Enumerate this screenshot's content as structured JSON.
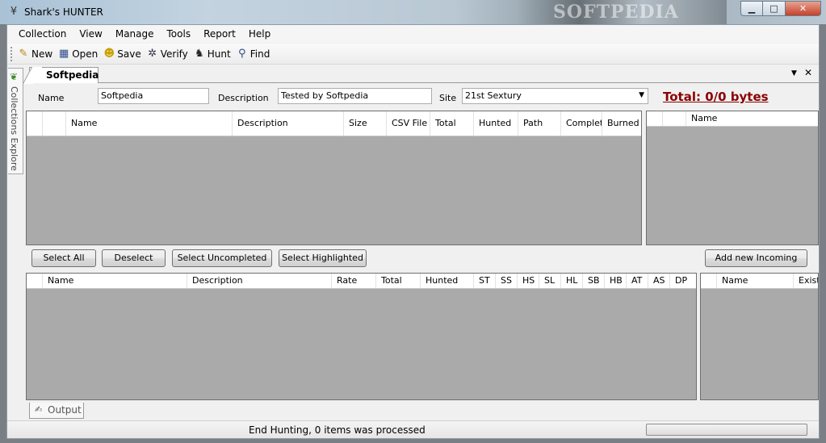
{
  "window": {
    "title": "Shark's HUNTER",
    "watermark": "SOFTPEDIA",
    "controls": [
      "minimize",
      "maximize",
      "close"
    ]
  },
  "menu": [
    "Collection",
    "View",
    "Manage",
    "Tools",
    "Report",
    "Help"
  ],
  "toolbar": [
    {
      "label": "New",
      "icon": "new-icon"
    },
    {
      "label": "Open",
      "icon": "open-icon"
    },
    {
      "label": "Save",
      "icon": "save-icon"
    },
    {
      "label": "Verify",
      "icon": "verify-icon"
    },
    {
      "label": "Hunt",
      "icon": "hunt-icon"
    },
    {
      "label": "Find",
      "icon": "find-icon"
    }
  ],
  "side_panel": {
    "label": "Collections Explore",
    "icon": "leaf-icon"
  },
  "doc_tab": {
    "label": "Softpedia",
    "dropdown_glyph": "▼",
    "close_glyph": "✕"
  },
  "form": {
    "name_label": "Name",
    "name_value": "Softpedia",
    "description_label": "Description",
    "description_value": "Tested by Softpedia",
    "site_label": "Site",
    "site_value": "21st Sextury",
    "total": "Total: 0/0 bytes"
  },
  "files_grid": {
    "columns": [
      "",
      "",
      "Name",
      "Description",
      "Size",
      "CSV File",
      "Total",
      "Hunted",
      "Path",
      "Complete",
      "Burned"
    ]
  },
  "incoming_grid": {
    "columns": [
      "",
      "",
      "Name"
    ]
  },
  "buttons": {
    "select_all": "Select All",
    "deselect": "Deselect",
    "select_uncompleted": "Select Uncompleted",
    "select_highlighted": "Select Highlighted",
    "add_new_incoming": "Add new Incoming"
  },
  "hunt_grid": {
    "columns": [
      "",
      "Name",
      "Description",
      "Rate",
      "Total",
      "Hunted",
      "ST",
      "SS",
      "HS",
      "SL",
      "HL",
      "SB",
      "HB",
      "AT",
      "AS",
      "DP"
    ]
  },
  "exists_grid": {
    "columns": [
      "",
      "Name",
      "Exists"
    ]
  },
  "output_tab": {
    "label": "Output"
  },
  "status": {
    "text": "End Hunting, 0 items was processed",
    "progress": 0
  }
}
